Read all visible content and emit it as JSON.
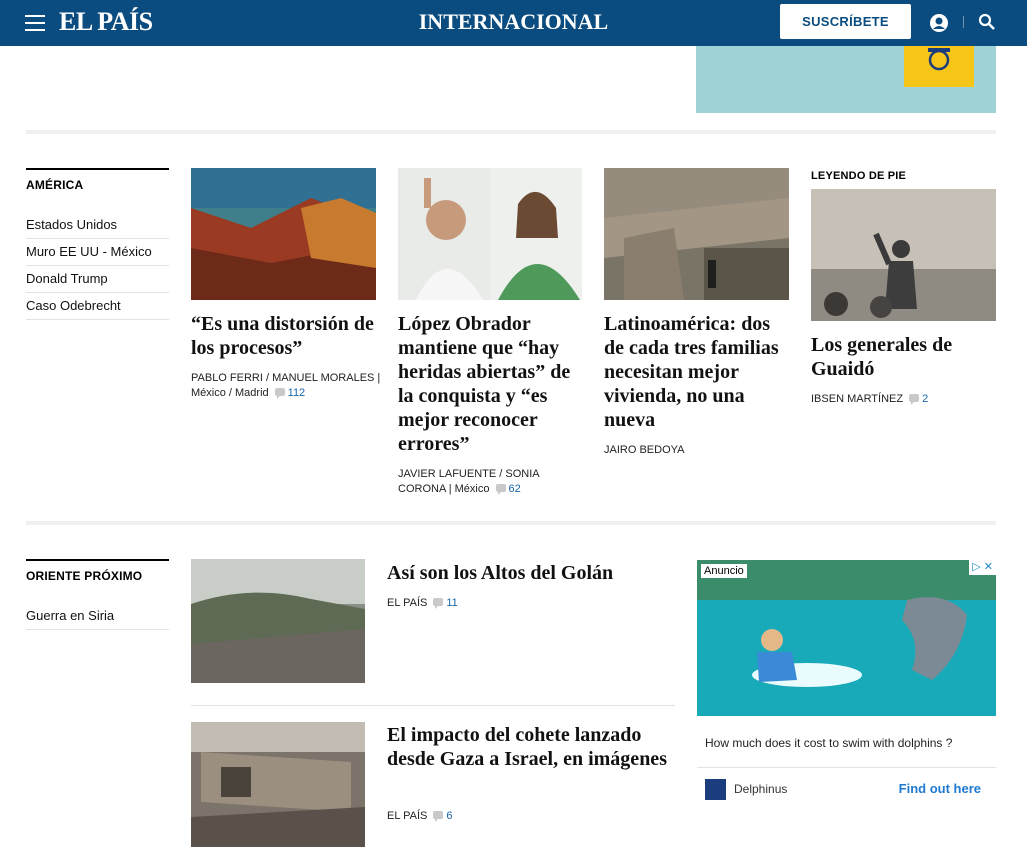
{
  "header": {
    "logo": "EL PAÍS",
    "section": "INTERNACIONAL",
    "subscribe_label": "SUSCRÍBETE"
  },
  "america": {
    "heading": "AMÉRICA",
    "links": [
      "Estados Unidos",
      "Muro EE UU - México",
      "Donald Trump",
      "Caso Odebrecht"
    ],
    "articles": [
      {
        "headline": "“Es una distorsión de los procesos”",
        "byline": "PABLO FERRI / MANUEL MORALES | México / Madrid",
        "comments": "112"
      },
      {
        "headline": "López Obrador mantiene que “hay heridas abiertas” de la conquista y “es mejor reconocer errores”",
        "byline": "JAVIER LAFUENTE / SONIA CORONA | México",
        "comments": "62"
      },
      {
        "headline": "Latinoamérica: dos de cada tres familias necesitan mejor vivienda, no una nueva",
        "byline": "JAIRO BEDOYA",
        "comments": ""
      },
      {
        "kicker": "LEYENDO DE PIE",
        "headline": "Los generales de Guaidó",
        "byline": "IBSEN MARTÍNEZ",
        "comments": "2"
      }
    ]
  },
  "oriente": {
    "heading": "ORIENTE PRÓXIMO",
    "links": [
      "Guerra en Siria"
    ],
    "articles": [
      {
        "headline": "Así son los Altos del Golán",
        "byline": "EL PAÍS",
        "comments": "11"
      },
      {
        "headline": "El impacto del cohete lanzado desde Gaza a Israel, en imágenes",
        "byline": "EL PAÍS",
        "comments": "6"
      }
    ]
  },
  "ad": {
    "label": "Anuncio",
    "text": "How much does it cost to swim with dolphins ?",
    "brand": "Delphinus",
    "cta": "Find out here"
  },
  "colors": {
    "brand_blue": "#0a4c7f",
    "link_blue": "#1765a9"
  }
}
